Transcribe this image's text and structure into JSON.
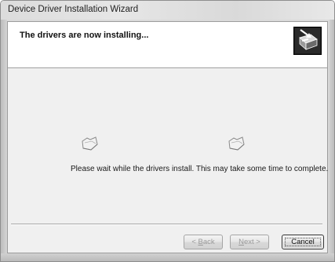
{
  "window": {
    "title": "Device Driver Installation Wizard"
  },
  "header": {
    "title": "The drivers are now installing...",
    "icon": "wizard-install-icon"
  },
  "body": {
    "message": "Please wait while the drivers install. This may take some time to complete.",
    "icons": [
      "folder-icon",
      "folder-icon"
    ]
  },
  "buttons": {
    "back_prefix": "< ",
    "back_accel": "B",
    "back_rest": "ack",
    "next_accel": "N",
    "next_rest": "ext >",
    "cancel_label": "Cancel",
    "back_enabled": false,
    "next_enabled": false
  },
  "colors": {
    "disabled_text": "#9a9a9a",
    "header_bg": "#ffffff",
    "body_bg": "#f0f0f0"
  }
}
